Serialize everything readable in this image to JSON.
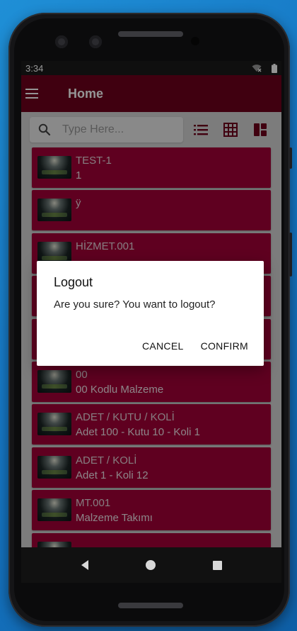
{
  "status": {
    "time": "3:34"
  },
  "appbar": {
    "title": "Home"
  },
  "search": {
    "placeholder": "Type Here..."
  },
  "list": {
    "items": [
      {
        "code": "TEST-1",
        "name": "1"
      },
      {
        "code": "ÿ",
        "name": ""
      },
      {
        "code": "HİZMET.001",
        "name": ""
      },
      {
        "code": "",
        "name": ""
      },
      {
        "code": "",
        "name": ""
      },
      {
        "code": "00",
        "name": "00 Kodlu Malzeme"
      },
      {
        "code": "ADET / KUTU / KOLİ",
        "name": "Adet 100 - Kutu 10 - Koli 1"
      },
      {
        "code": "ADET / KOLİ",
        "name": "Adet 1 - Koli 12"
      },
      {
        "code": "MT.001",
        "name": "Malzeme Takımı"
      },
      {
        "code": "",
        "name": ""
      }
    ]
  },
  "dialog": {
    "title": "Logout",
    "message": "Are you sure? You want to logout?",
    "cancel_label": "CANCEL",
    "confirm_label": "CONFIRM"
  },
  "colors": {
    "appbar": "#6f001d",
    "list_item": "#a40038",
    "icon_accent": "#6f001d"
  },
  "icons": {
    "menu": "menu-icon",
    "search": "search-icon",
    "list_view": "list-view-icon",
    "grid_view": "grid-view-icon",
    "tile_view": "tile-view-icon"
  }
}
